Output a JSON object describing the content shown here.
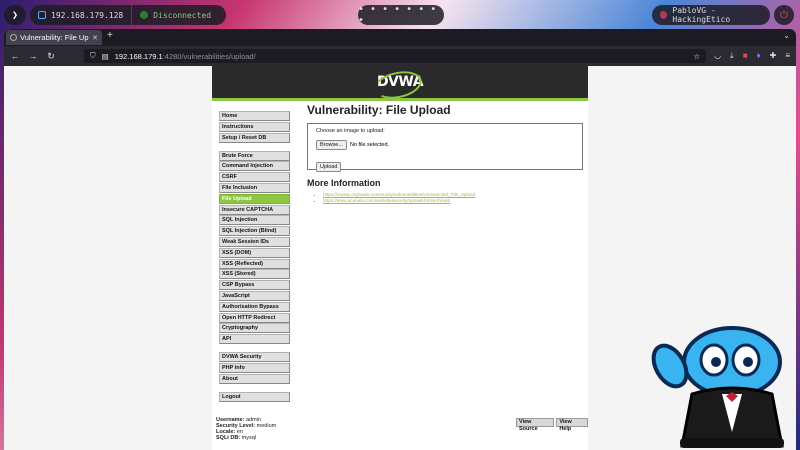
{
  "desktop": {
    "launcher_icon": "arch-logo-icon",
    "terminal_host": "192.168.179.128",
    "vpn_status": "Disconnected",
    "workspace_dots": "• • • • • • • •",
    "user_label": "PabloVG - HackingEtico",
    "power_icon": "power-icon"
  },
  "browser": {
    "tab_title": "Vulnerability: File Upload",
    "tab_close": "✕",
    "new_tab": "+",
    "url_host": "192.168.179.1",
    "url_path": ":4280/vulnerabilities/upload/"
  },
  "dvwa": {
    "logo": "DVWA",
    "menu_groups": [
      [
        "Home",
        "Instructions",
        "Setup / Reset DB"
      ],
      [
        "Brute Force",
        "Command Injection",
        "CSRF",
        "File Inclusion",
        "File Upload",
        "Insecure CAPTCHA",
        "SQL Injection",
        "SQL Injection (Blind)",
        "Weak Session IDs",
        "XSS (DOM)",
        "XSS (Reflected)",
        "XSS (Stored)",
        "CSP Bypass",
        "JavaScript",
        "Authorisation Bypass",
        "Open HTTP Redirect",
        "Cryptography",
        "API"
      ],
      [
        "DVWA Security",
        "PHP Info",
        "About"
      ],
      [
        "Logout"
      ]
    ],
    "selected_item": "File Upload",
    "page_title": "Vulnerability: File Upload",
    "upload": {
      "prompt": "Choose an image to upload:",
      "browse_label": "Browse...",
      "file_status": "No file selected.",
      "upload_label": "Upload"
    },
    "more_info_title": "More Information",
    "links": [
      "https://owasp.org/www-community/vulnerabilities/Unrestricted_File_Upload",
      "https://www.acunetix.com/websitesecurity/upload-forms-threat/"
    ],
    "footer": {
      "username_label": "Username:",
      "username": "admin",
      "security_label": "Security Level:",
      "security": "medium",
      "locale_label": "Locale:",
      "locale": "en",
      "sqli_label": "SQLi DB:",
      "sqli": "mysql"
    },
    "view_source": "View Source",
    "view_help": "View Help"
  },
  "colors": {
    "accent": "#8dc63f",
    "header_bg": "#2a2a2a",
    "browser_chrome": "#2b2a33"
  }
}
